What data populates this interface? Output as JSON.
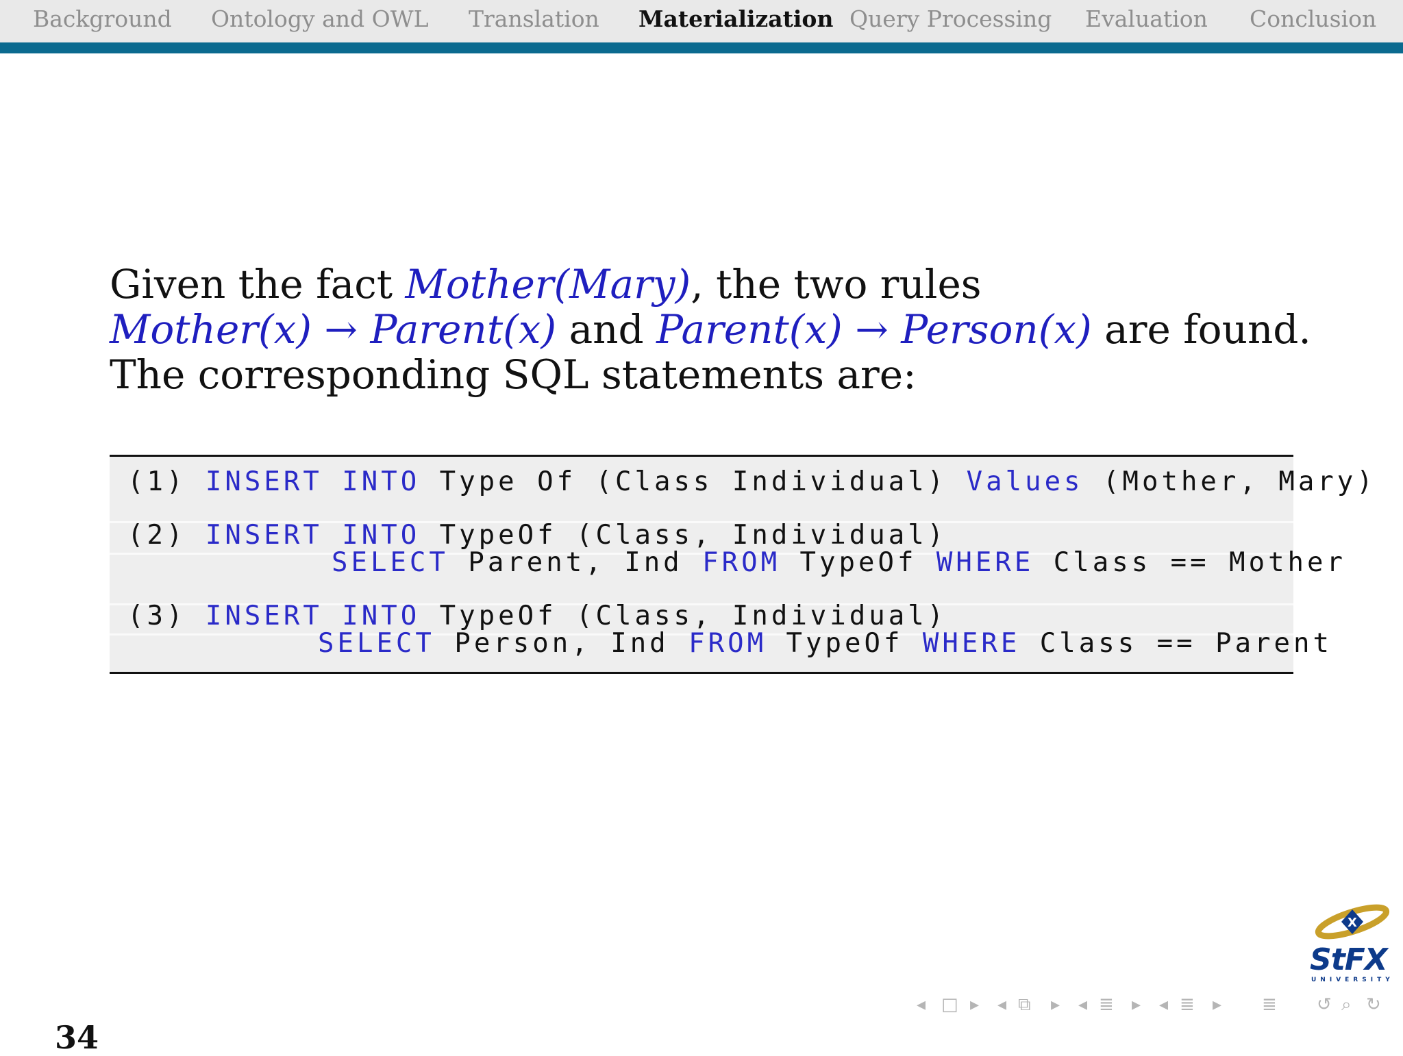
{
  "nav": {
    "items": [
      {
        "label": "Background"
      },
      {
        "label": "Ontology and OWL"
      },
      {
        "label": "Translation"
      },
      {
        "label": "Materialization"
      },
      {
        "label": "Query Processing"
      },
      {
        "label": "Evaluation"
      },
      {
        "label": "Conclusion"
      }
    ],
    "active": "Materialization",
    "accent_color": "#0b6a8f"
  },
  "intro": {
    "l1_a": "Given the fact ",
    "l1_math": "Mother(Mary)",
    "l1_b": ", the two rules",
    "l2_math1": "Mother(x) → Parent(x)",
    "l2_mid": " and ",
    "l2_math2": "Parent(x) → Person(x)",
    "l2_end": " are found.",
    "l3": "The corresponding SQL statements are:"
  },
  "code": {
    "line1": {
      "num": "(1) ",
      "k1": "INSERT INTO",
      "t1": " Type Of (Class Individual) ",
      "k2": "Values",
      "t2": " (Mother, Mary)"
    },
    "line2": {
      "num": "(2) ",
      "k1": "INSERT INTO",
      "t1": " TypeOf (Class, Individual)"
    },
    "line3": {
      "k1": "SELECT",
      "t1": " Parent, Ind ",
      "k2": "FROM",
      "t2": " TypeOf ",
      "k3": "WHERE",
      "t3": " Class == Mother"
    },
    "line4": {
      "num": "(3) ",
      "k1": "INSERT INTO",
      "t1": " TypeOf (Class, Individual)"
    },
    "line5": {
      "k1": "SELECT",
      "t1": " Person, Ind ",
      "k2": "FROM",
      "t2": " TypeOf ",
      "k3": "WHERE",
      "t3": " Class == Parent"
    }
  },
  "footer": {
    "page_number": "34",
    "logo_text": "StFX",
    "logo_subtext": "UNIVERSITY",
    "controls": [
      {
        "icon": "prev-icon",
        "glyph": "◂"
      },
      {
        "icon": "frame-icon",
        "glyph": "□"
      },
      {
        "icon": "next-icon",
        "glyph": "▸"
      },
      {
        "icon": "prev-icon",
        "glyph": "◂"
      },
      {
        "icon": "frames-icon",
        "glyph": "⧉"
      },
      {
        "icon": "next-icon",
        "glyph": "▸"
      },
      {
        "icon": "prev-icon",
        "glyph": "◂"
      },
      {
        "icon": "subsection-icon",
        "glyph": "≣"
      },
      {
        "icon": "next-icon",
        "glyph": "▸"
      },
      {
        "icon": "prev-icon",
        "glyph": "◂"
      },
      {
        "icon": "section-icon",
        "glyph": "≣"
      },
      {
        "icon": "next-icon",
        "glyph": "▸"
      },
      {
        "icon": "menu-icon",
        "glyph": "≣"
      },
      {
        "icon": "undo-icon",
        "glyph": "↺"
      },
      {
        "icon": "search-icon",
        "glyph": "⌕"
      },
      {
        "icon": "redo-icon",
        "glyph": "↻"
      }
    ]
  }
}
